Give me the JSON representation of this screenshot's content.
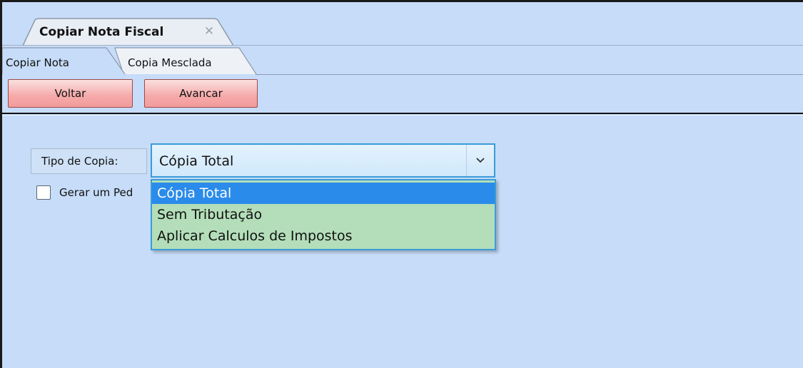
{
  "document_tab": {
    "title": "Copiar Nota Fiscal",
    "close_icon": "close-icon"
  },
  "tabs": [
    {
      "label": "Copiar Nota",
      "active": true
    },
    {
      "label": "Copia Mesclada",
      "active": false
    }
  ],
  "toolbar": {
    "back_label": "Voltar",
    "next_label": "Avancar"
  },
  "form": {
    "copy_type_label": "Tipo de Copia:",
    "copy_type_value": "Cópia Total",
    "copy_type_options": [
      "Cópia Total",
      "Sem Tributação",
      "Aplicar Calculos de Impostos"
    ],
    "checkbox_label": "Gerar um Ped",
    "checkbox_checked": false
  },
  "colors": {
    "background": "#c6dcf8",
    "button": "#f6a9a9",
    "selected_option": "#2a8bea",
    "dropdown": "#b3deb9",
    "focus_border": "#3b9bd8"
  }
}
